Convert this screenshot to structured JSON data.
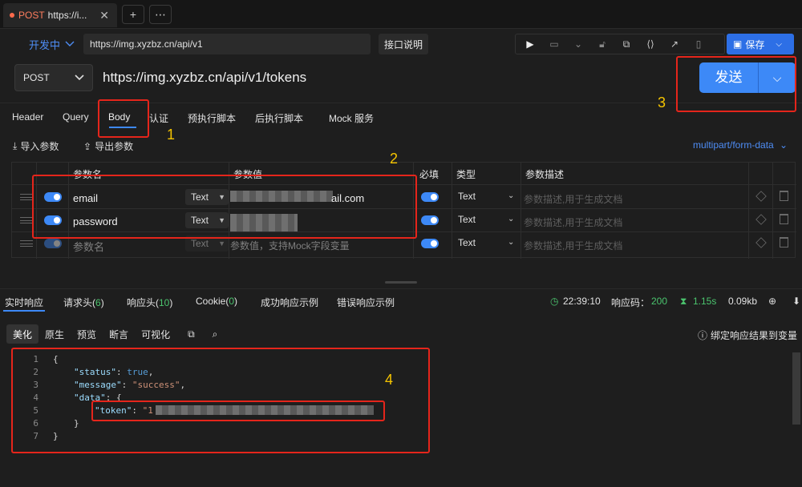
{
  "tab": {
    "method": "POST",
    "title": "https://i...",
    "close": "✕",
    "add": "+",
    "more": "⋯"
  },
  "env": {
    "name": "开发中",
    "url": "https://img.xyzbz.cn/api/v1",
    "doc_button": "接口说明"
  },
  "toolbar": {
    "save_label": "保存"
  },
  "request": {
    "method": "POST",
    "url": "https://img.xyzbz.cn/api/v1/tokens",
    "send_label": "发送"
  },
  "req_tabs": [
    "Header",
    "Query",
    "Body",
    "认证",
    "预执行脚本",
    "后执行脚本",
    "Mock 服务"
  ],
  "body_actions": {
    "import": "导入参数",
    "export": "导出参数",
    "content_type": "multipart/form-data"
  },
  "params_table": {
    "headers": {
      "name": "参数名",
      "value": "参数值",
      "required": "必填",
      "type": "类型",
      "desc": "参数描述"
    },
    "rows": [
      {
        "name": "email",
        "type": "Text",
        "value": "ail.com",
        "vtype": "Text",
        "desc": "参数描述,用于生成文档"
      },
      {
        "name": "password",
        "type": "Text",
        "value": "",
        "vtype": "Text",
        "desc": "参数描述,用于生成文档"
      },
      {
        "name": "参数名",
        "type": "Text",
        "value": "参数值，支持Mock字段变量",
        "vtype": "Text",
        "desc": "参数描述,用于生成文档"
      }
    ]
  },
  "response_tabs": {
    "realtime": "实时响应",
    "req_headers": "请求头(",
    "req_headers_count": "6",
    "req_headers_close": ")",
    "resp_headers": "响应头(",
    "resp_headers_count": "10",
    "resp_headers_close": ")",
    "cookie": "Cookie(",
    "cookie_count": "0",
    "cookie_close": ")",
    "success_example": "成功响应示例",
    "error_example": "错误响应示例"
  },
  "response_stats": {
    "time": "22:39:10",
    "code_label": "响应码：",
    "code": "200",
    "duration": "1.15s",
    "size": "0.09kb"
  },
  "view_tabs": [
    "美化",
    "原生",
    "预览",
    "断言",
    "可视化"
  ],
  "bind_label": "绑定响应结果到变量",
  "code": {
    "line_numbers": [
      "1",
      "2",
      "3",
      "4",
      "5",
      "6",
      "7"
    ],
    "status_key": "\"status\"",
    "status_val": "true",
    "message_key": "\"message\"",
    "message_val": "\"success\"",
    "data_key": "\"data\"",
    "token_key": "\"token\"",
    "token_val": "\"1"
  },
  "annotations": [
    "1",
    "2",
    "3",
    "4"
  ],
  "colors": {
    "accent": "#3d89f7",
    "method": "#ff7d5e",
    "success": "#4bc46e",
    "annotation": "#e5251b",
    "annotation_number": "#f5c400"
  }
}
